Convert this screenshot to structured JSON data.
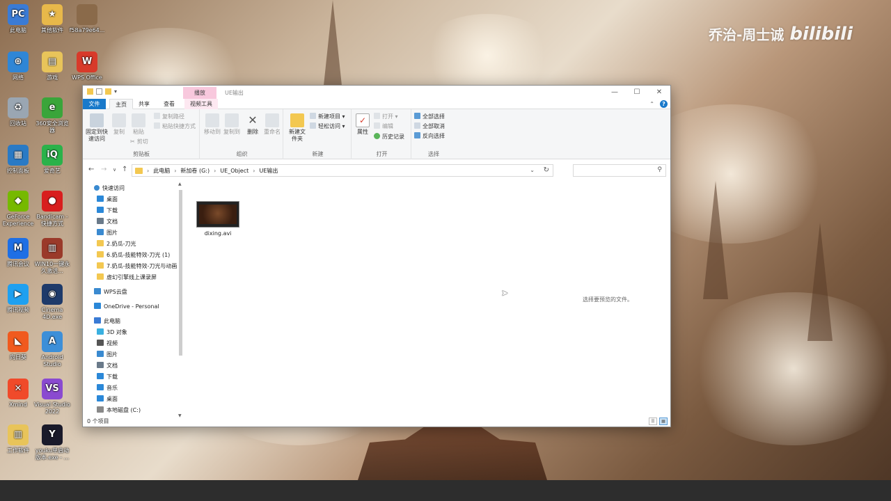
{
  "watermark": {
    "author": "乔治-周士诚",
    "brand": "bilibili"
  },
  "desktop_icons": [
    {
      "label": "此电脑",
      "color": "#3a7bd5",
      "glyph": "PC"
    },
    {
      "label": "其他软件",
      "color": "#e8b84a",
      "glyph": "★"
    },
    {
      "label": "f58a79e64...",
      "color": "#8a6a4a",
      "glyph": ""
    },
    {
      "label": "网络",
      "color": "#2f86d6",
      "glyph": "⊕"
    },
    {
      "label": "游戏",
      "color": "#e8c45a",
      "glyph": "▤"
    },
    {
      "label": "WPS Office",
      "color": "#d83a2a",
      "glyph": "W"
    },
    {
      "label": "回收站",
      "color": "#9aa6b2",
      "glyph": "♻"
    },
    {
      "label": "360安全浏览器",
      "color": "#3aa53a",
      "glyph": "e"
    },
    {
      "label": "控制面板",
      "color": "#2a7ac5",
      "glyph": "▦"
    },
    {
      "label": "爱奇艺",
      "color": "#2ab24a",
      "glyph": "iQ"
    },
    {
      "label": "GeForce Experience",
      "color": "#76b900",
      "glyph": "◆"
    },
    {
      "label": "Bandicam - 快捷方式",
      "color": "#d81e1e",
      "glyph": "●"
    },
    {
      "label": "腾讯会议",
      "color": "#1e6fe5",
      "glyph": "M"
    },
    {
      "label": "WIN10一键永久激活...",
      "color": "#9a3a2a",
      "glyph": "▥"
    },
    {
      "label": "腾讯视频",
      "color": "#1fa0f0",
      "glyph": "▶"
    },
    {
      "label": "Cinema 4D.exe",
      "color": "#1e3a6a",
      "glyph": "◉"
    },
    {
      "label": "向日葵",
      "color": "#f05a1e",
      "glyph": "◣"
    },
    {
      "label": "Android Studio",
      "color": "#3d8fd8",
      "glyph": "A"
    },
    {
      "label": "Xmind",
      "color": "#f04a2a",
      "glyph": "✕"
    },
    {
      "label": "Visual Studio 2022",
      "color": "#8a4ad0",
      "glyph": "VS"
    },
    {
      "label": "工作软件",
      "color": "#e8c45a",
      "glyph": "▥"
    },
    {
      "label": "youku单启动版本.exe - ...",
      "color": "#1a1a2a",
      "glyph": "Y"
    }
  ],
  "window": {
    "title": "UE输出",
    "tool_tab_header": "播放",
    "controls": [
      "—",
      "☐",
      "✕"
    ]
  },
  "ribbon_tabs": {
    "file": "文件",
    "home": "主页",
    "share": "共享",
    "view": "查看",
    "video_tools": "视频工具"
  },
  "ribbon": {
    "clipboard": {
      "group": "剪贴板",
      "pin": "固定到快速访问",
      "copy": "复制",
      "paste": "粘贴",
      "copy_path": "复制路径",
      "paste_shortcut": "粘贴快捷方式",
      "cut": "剪切"
    },
    "organize": {
      "group": "组织",
      "move_to": "移动到",
      "copy_to": "复制到",
      "delete": "删除",
      "rename": "重命名"
    },
    "new": {
      "group": "新建",
      "new_folder": "新建文件夹",
      "new_item": "新建项目",
      "easy_access": "轻松访问"
    },
    "open": {
      "group": "打开",
      "properties": "属性",
      "open": "打开",
      "edit": "编辑",
      "history": "历史记录"
    },
    "select": {
      "group": "选择",
      "select_all": "全部选择",
      "select_none": "全部取消",
      "invert": "反向选择"
    }
  },
  "address": {
    "crumbs": [
      "此电脑",
      "新加卷 (G:)",
      "UE_Object",
      "UE输出"
    ],
    "search_placeholder": ""
  },
  "nav": {
    "quick_access": "快速访问",
    "items": [
      {
        "label": "桌面",
        "indent": 1,
        "color": "#2b88d8",
        "pinned": true
      },
      {
        "label": "下载",
        "indent": 1,
        "color": "#2b88d8",
        "pinned": true
      },
      {
        "label": "文档",
        "indent": 1,
        "color": "#6a7a8a",
        "pinned": true
      },
      {
        "label": "图片",
        "indent": 1,
        "color": "#3a8ad0",
        "pinned": true
      },
      {
        "label": "2.奶瓜-刀光",
        "indent": 1,
        "color": "#f3c851",
        "pinned": false
      },
      {
        "label": "6.奶瓜-技能特效-刀光 (1)",
        "indent": 1,
        "color": "#f3c851",
        "pinned": false
      },
      {
        "label": "7.奶瓜-技能特效-刀光与动画",
        "indent": 1,
        "color": "#f3c851",
        "pinned": false
      },
      {
        "label": "虚幻引擎线上课录屏",
        "indent": 1,
        "color": "#f3c851",
        "pinned": false
      },
      {
        "label": "WPS云盘",
        "indent": 0,
        "color": "#3a8ad0",
        "pinned": false
      },
      {
        "label": "OneDrive - Personal",
        "indent": 0,
        "color": "#2b88d8",
        "pinned": false
      },
      {
        "label": "此电脑",
        "indent": 0,
        "color": "#3a7bd5",
        "pinned": false
      },
      {
        "label": "3D 对象",
        "indent": 1,
        "color": "#3ab0e0",
        "pinned": false
      },
      {
        "label": "视频",
        "indent": 1,
        "color": "#555",
        "pinned": false
      },
      {
        "label": "图片",
        "indent": 1,
        "color": "#3a8ad0",
        "pinned": false
      },
      {
        "label": "文档",
        "indent": 1,
        "color": "#6a7a8a",
        "pinned": false
      },
      {
        "label": "下载",
        "indent": 1,
        "color": "#2b88d8",
        "pinned": false
      },
      {
        "label": "音乐",
        "indent": 1,
        "color": "#2b88d8",
        "pinned": false
      },
      {
        "label": "桌面",
        "indent": 1,
        "color": "#2b88d8",
        "pinned": false
      },
      {
        "label": "本地磁盘 (C:)",
        "indent": 1,
        "color": "#888",
        "pinned": false
      }
    ]
  },
  "files": [
    {
      "name": "dixing.avi"
    }
  ],
  "preview_message": "选择要预览的文件。",
  "status": {
    "count": "0 个项目"
  }
}
